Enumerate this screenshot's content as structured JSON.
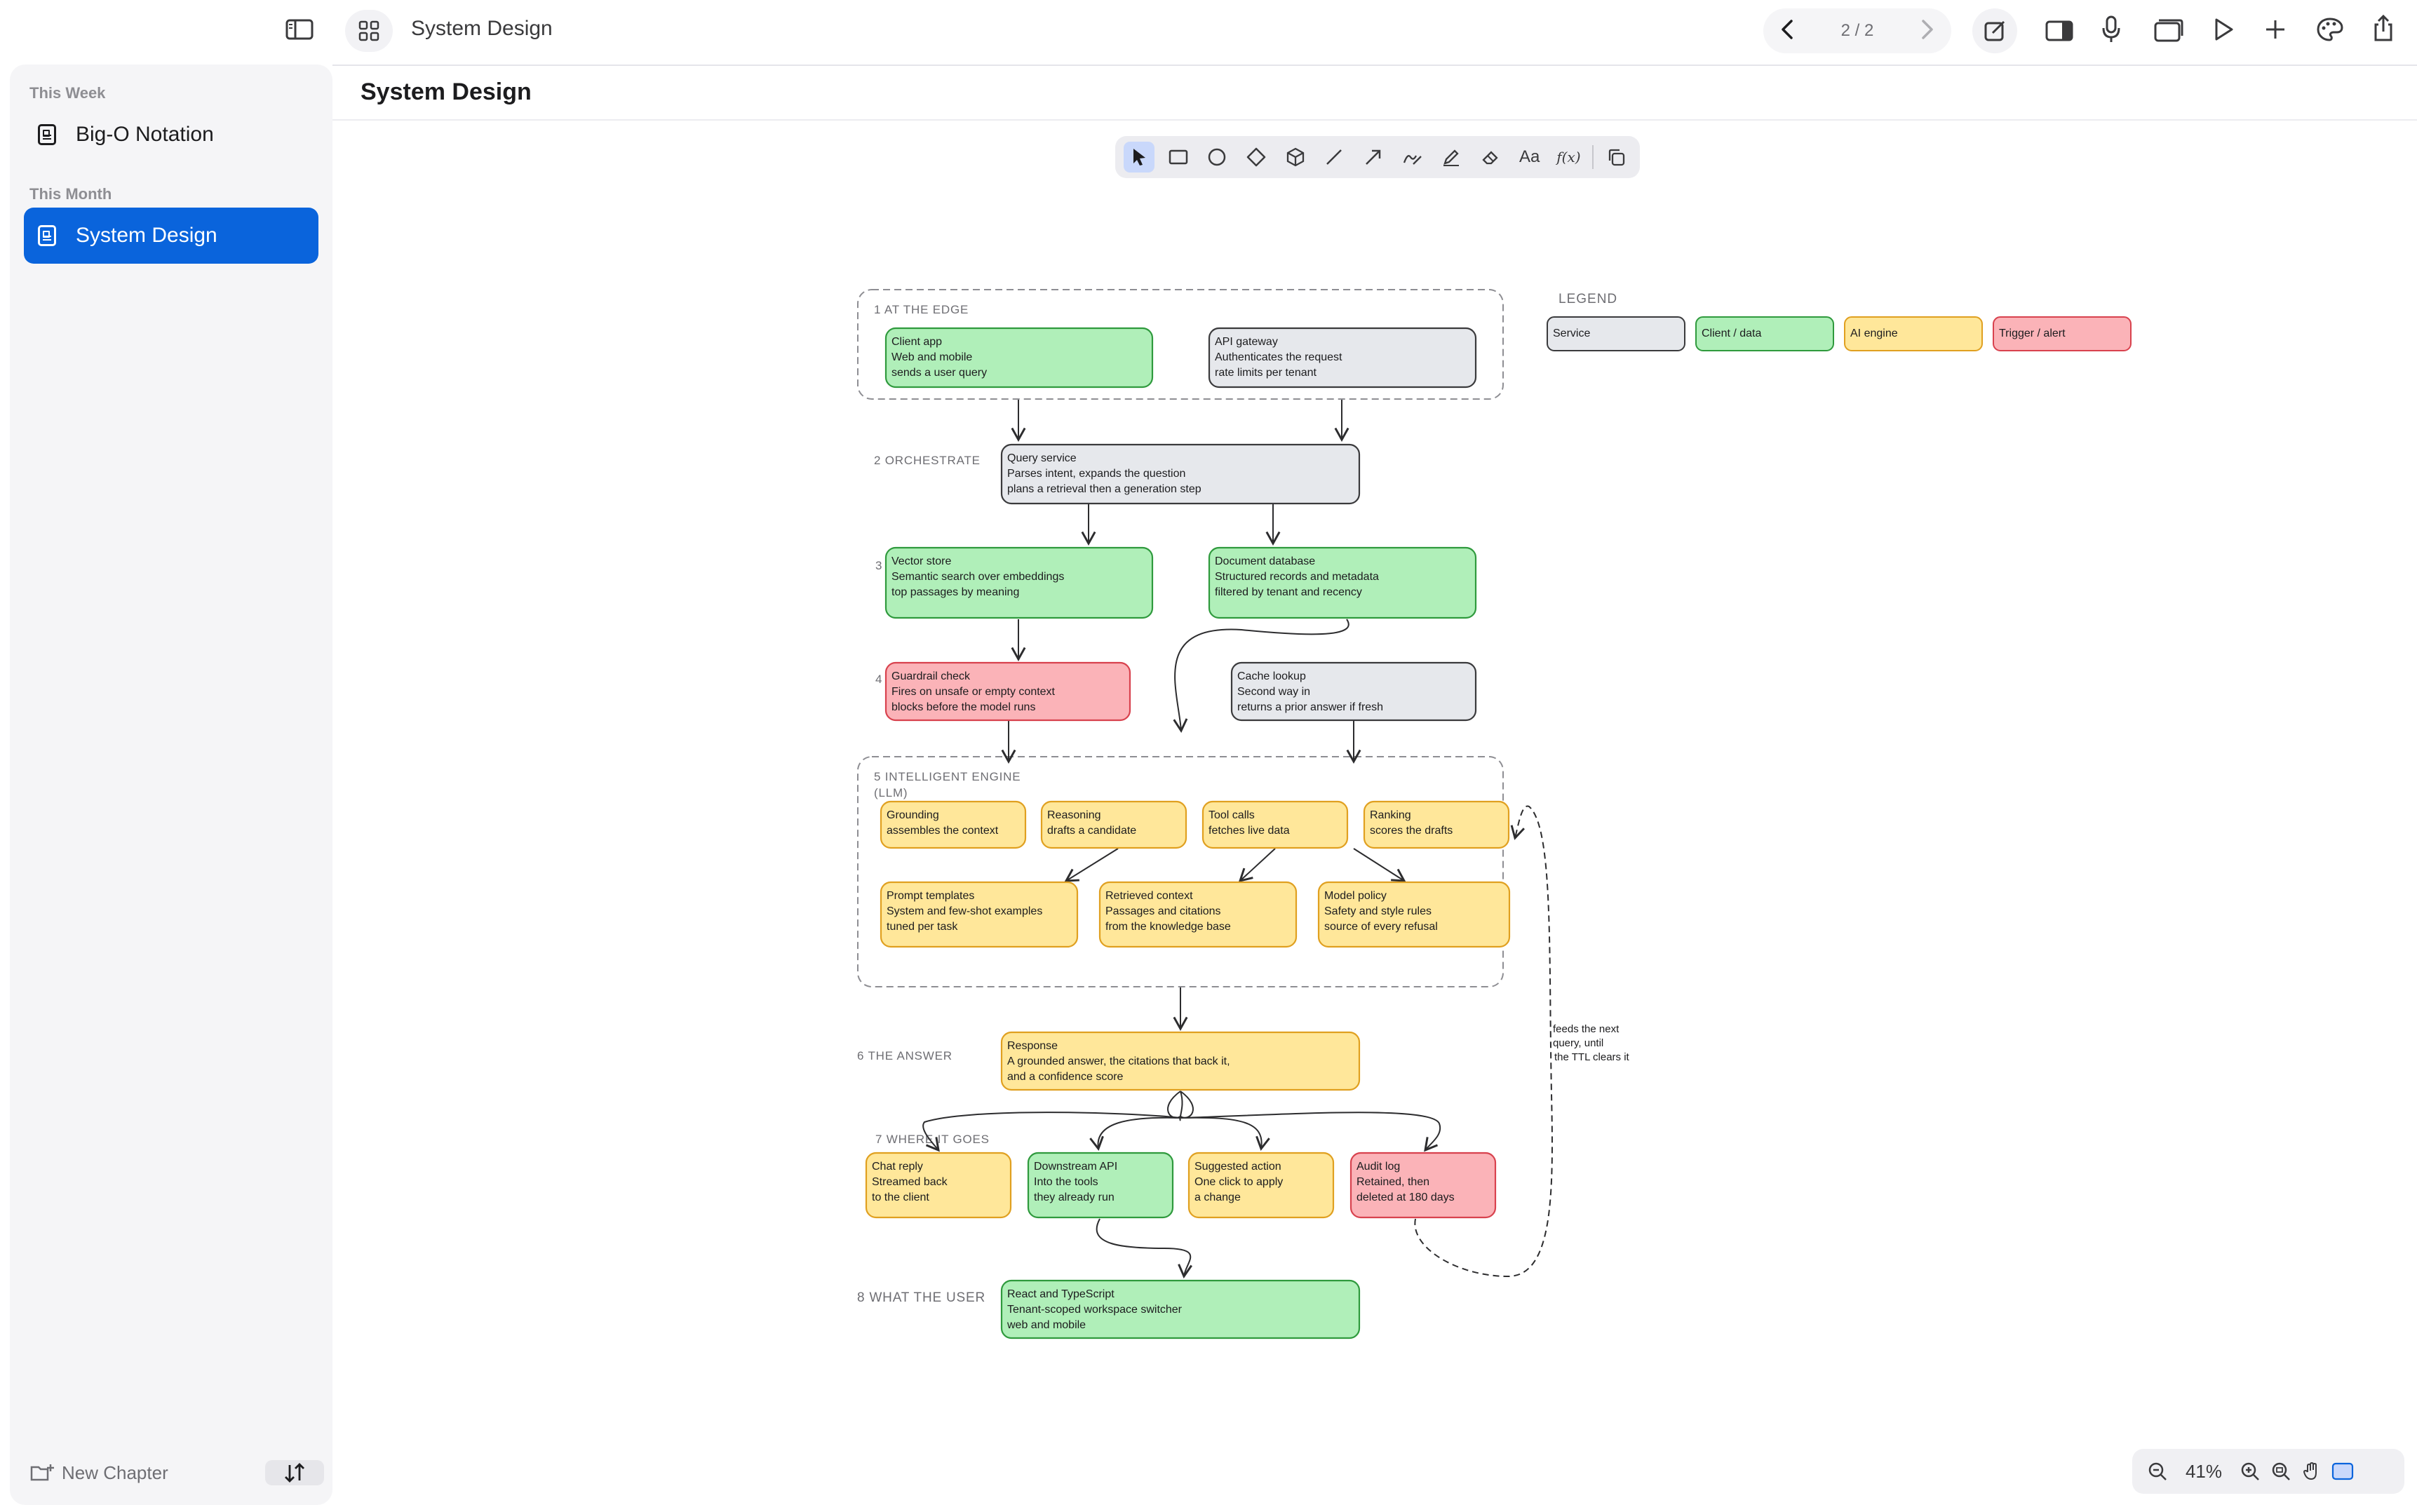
{
  "header": {
    "app_title": "System Design",
    "pager": "2 / 2"
  },
  "sidebar": {
    "sections": [
      {
        "label": "This Week",
        "items": [
          {
            "label": "Big-O Notation",
            "active": false
          }
        ]
      },
      {
        "label": "This Month",
        "items": [
          {
            "label": "System Design",
            "active": true
          }
        ]
      }
    ],
    "new_chapter": "New Chapter"
  },
  "page": {
    "title": "System Design"
  },
  "toolbar": {
    "tools": [
      "select-tool",
      "rectangle-tool",
      "ellipse-tool",
      "diamond-tool",
      "cube-tool",
      "line-tool",
      "arrow-tool",
      "freehand-tool",
      "pen-tool",
      "eraser-tool",
      "text-tool",
      "formula-tool",
      "duplicate-tool"
    ],
    "text_tool_label": "Aa",
    "formula_tool_label": "f(x)"
  },
  "zoom": {
    "value": "41%"
  },
  "colors": {
    "accent": "#0a64dc",
    "service": "#e6e8ec",
    "client_data": "#b0efb9",
    "ai_engine": "#ffe79a",
    "trigger_alert": "#fbb3b8"
  },
  "diagram": {
    "legend_title": "LEGEND",
    "legend": [
      "Service",
      "Client / data",
      "AI engine",
      "Trigger / alert"
    ],
    "groups": {
      "edge": "1  AT THE EDGE",
      "engine_l1": "5  INTELLIGENT ENGINE",
      "engine_l2": "(LLM)"
    },
    "step_labels": {
      "orchestrate": "2  ORCHESTRATE",
      "s3": "3",
      "s4": "4",
      "answer": "6  THE ANSWER",
      "where": "7  WHERE IT GOES",
      "user": "8  WHAT THE USER"
    },
    "nodes": {
      "client_app": [
        "Client app",
        "Web and mobile",
        "sends a user query"
      ],
      "api_gateway": [
        "API gateway",
        "Authenticates the request",
        "rate limits per tenant"
      ],
      "query_service": [
        "Query service",
        "Parses intent, expands the question",
        "plans a retrieval then a generation step"
      ],
      "vector_store": [
        "Vector store",
        "Semantic search over embeddings",
        "top passages by meaning"
      ],
      "document_db": [
        "Document database",
        "Structured records and metadata",
        "filtered by tenant and recency"
      ],
      "guardrail": [
        "Guardrail check",
        "Fires on unsafe or empty context",
        "blocks before the model runs"
      ],
      "cache": [
        "Cache lookup",
        "Second way in",
        "returns a prior answer if fresh"
      ],
      "grounding": [
        "Grounding",
        "assembles the context"
      ],
      "reasoning": [
        "Reasoning",
        "drafts a candidate"
      ],
      "tool_calls": [
        "Tool calls",
        "fetches live data"
      ],
      "ranking": [
        "Ranking",
        "scores the drafts"
      ],
      "prompt_templates": [
        "Prompt templates",
        "System and few-shot examples",
        "tuned per task"
      ],
      "retrieved_context": [
        "Retrieved context",
        "Passages and citations",
        "from the knowledge base"
      ],
      "model_policy": [
        "Model policy",
        "Safety and style rules",
        "source of every refusal"
      ],
      "response": [
        "Response",
        "A grounded answer, the citations that back it,",
        "and a confidence score"
      ],
      "chat_reply": [
        "Chat reply",
        "Streamed back",
        "to the client"
      ],
      "downstream_api": [
        "Downstream API",
        "Into the tools",
        "they already run"
      ],
      "suggested_action": [
        "Suggested action",
        "One click to apply",
        "a change"
      ],
      "audit_log": [
        "Audit log",
        "Retained, then",
        "deleted at 180 days"
      ],
      "frontend": [
        "React and TypeScript",
        "Tenant-scoped workspace switcher",
        "web and mobile"
      ]
    },
    "feedback_note": [
      "feeds the next",
      "query, until",
      "the TTL clears it"
    ]
  }
}
